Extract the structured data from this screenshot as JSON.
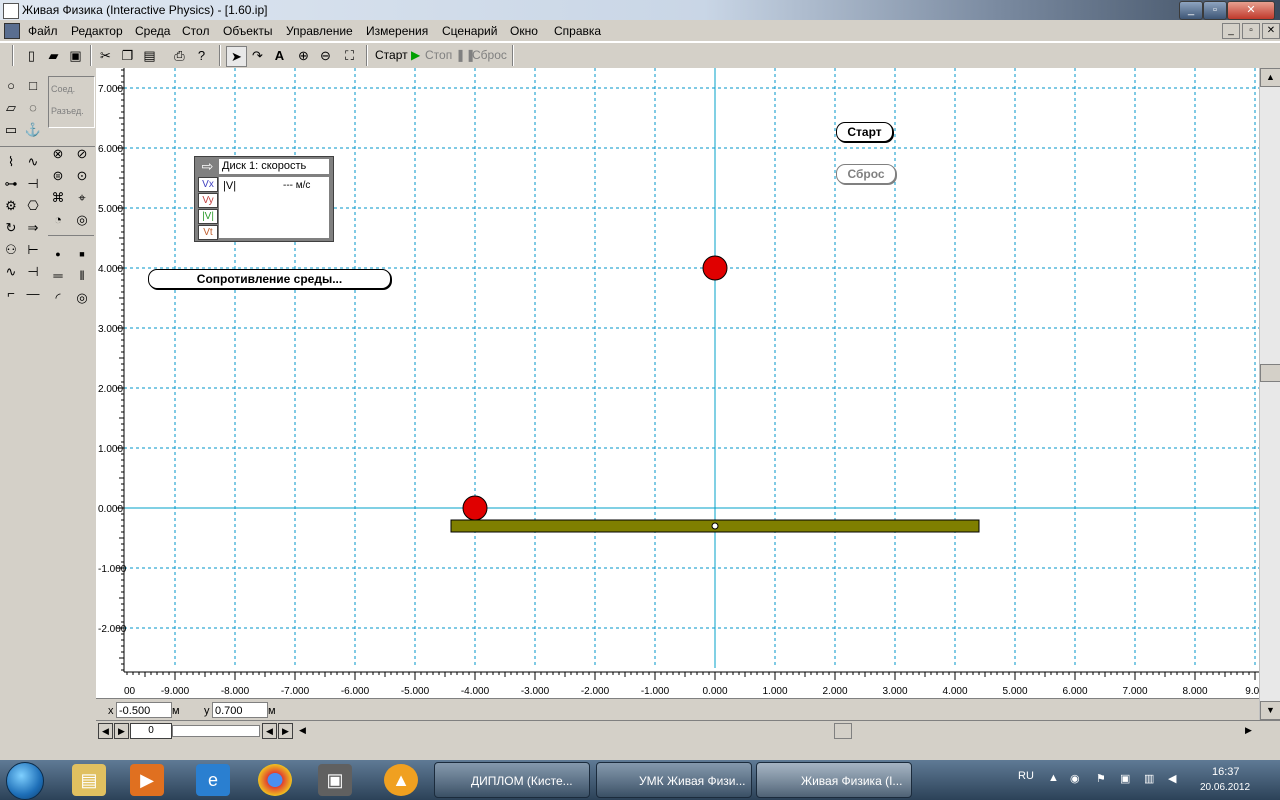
{
  "window": {
    "title": "Живая Физика (Interactive Physics) - [1.60.ip]"
  },
  "menu": [
    "Файл",
    "Редактор",
    "Среда",
    "Стол",
    "Объекты",
    "Управление",
    "Измерения",
    "Сценарий",
    "Окно",
    "Справка"
  ],
  "toolbar": {
    "start_label": "Старт",
    "stop_label": "Стоп",
    "reset_label": "Сброс"
  },
  "palette": {
    "join_label": "Соед.",
    "split_label": "Разъед."
  },
  "meter": {
    "title": "Диск 1: скорость",
    "channels": [
      "Vx",
      "Vy",
      "|V|",
      "Vt"
    ],
    "readout_label": "|V|",
    "readout_value": "--- м/с"
  },
  "canvas_buttons": {
    "start": "Старт",
    "reset": "Сброс",
    "drag": "Сопротивление среды..."
  },
  "axes": {
    "x_ticks": [
      "-9.000",
      "-8.000",
      "-7.000",
      "-6.000",
      "-5.000",
      "-4.000",
      "-3.000",
      "-2.000",
      "-1.000",
      "0.000",
      "1.000",
      "2.000",
      "3.000",
      "4.000",
      "5.000",
      "6.000",
      "7.000",
      "8.000",
      "9.00"
    ],
    "x_left_fragment": "00",
    "y_ticks": [
      "7.000",
      "6.000",
      "5.000",
      "4.000",
      "3.000",
      "2.000",
      "1.000",
      "0.000",
      "-1.000",
      "-2.000"
    ]
  },
  "scene": {
    "disk_top": {
      "x": 0.0,
      "y": 4.0,
      "radius": 0.2,
      "color": "#e00000"
    },
    "disk_bottom": {
      "x": -4.0,
      "y": 0.0,
      "radius": 0.2,
      "color": "#e00000"
    },
    "plank": {
      "x_min": -4.4,
      "x_max": 4.4,
      "y_top": -0.2,
      "y_bottom": -0.4,
      "color": "#7f7f00"
    }
  },
  "status": {
    "x_label": "x",
    "x_value": "-0.500",
    "x_unit": "м",
    "y_label": "y",
    "y_value": "0.700",
    "y_unit": "м",
    "frame_value": "0"
  },
  "taskbar": {
    "tasks": [
      "ДИПЛОМ (Кисте...",
      "УМК Живая Физи...",
      "Живая Физика (I..."
    ],
    "lang": "RU",
    "time": "16:37",
    "date": "20.06.2012"
  },
  "colors": {
    "grid": "#0096c8",
    "axis": "#00a0c8",
    "disk": "#e00000",
    "plank": "#7f7f00"
  }
}
